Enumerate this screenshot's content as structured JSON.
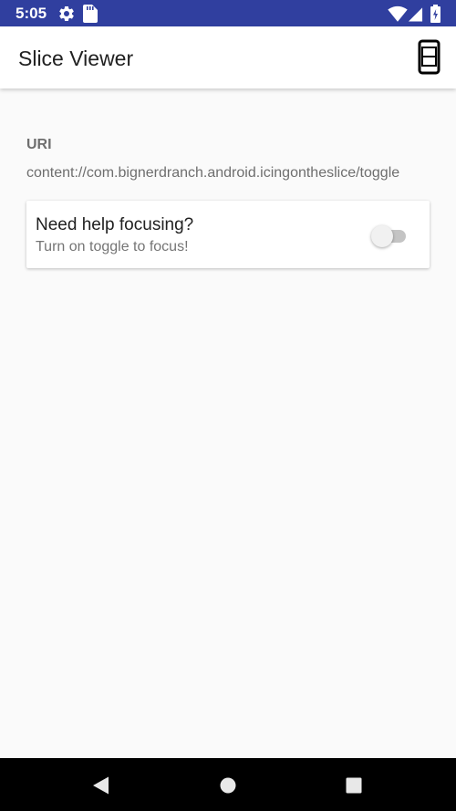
{
  "status_bar": {
    "time": "5:05",
    "background": "#303f9f",
    "icons": [
      "settings-icon",
      "sd-card-icon",
      "wifi-icon",
      "cell-signal-icon",
      "battery-charging-icon"
    ]
  },
  "app_bar": {
    "title": "Slice Viewer",
    "action_icon": "phone-icon"
  },
  "content": {
    "uri_label": "URI",
    "uri_value": "content://com.bignerdranch.android.icingontheslice/toggle"
  },
  "slice": {
    "title": "Need help focusing?",
    "subtitle": "Turn on toggle to focus!",
    "toggle_on": false
  },
  "nav_bar": {
    "buttons": [
      "back-icon",
      "home-icon",
      "recents-icon"
    ]
  }
}
